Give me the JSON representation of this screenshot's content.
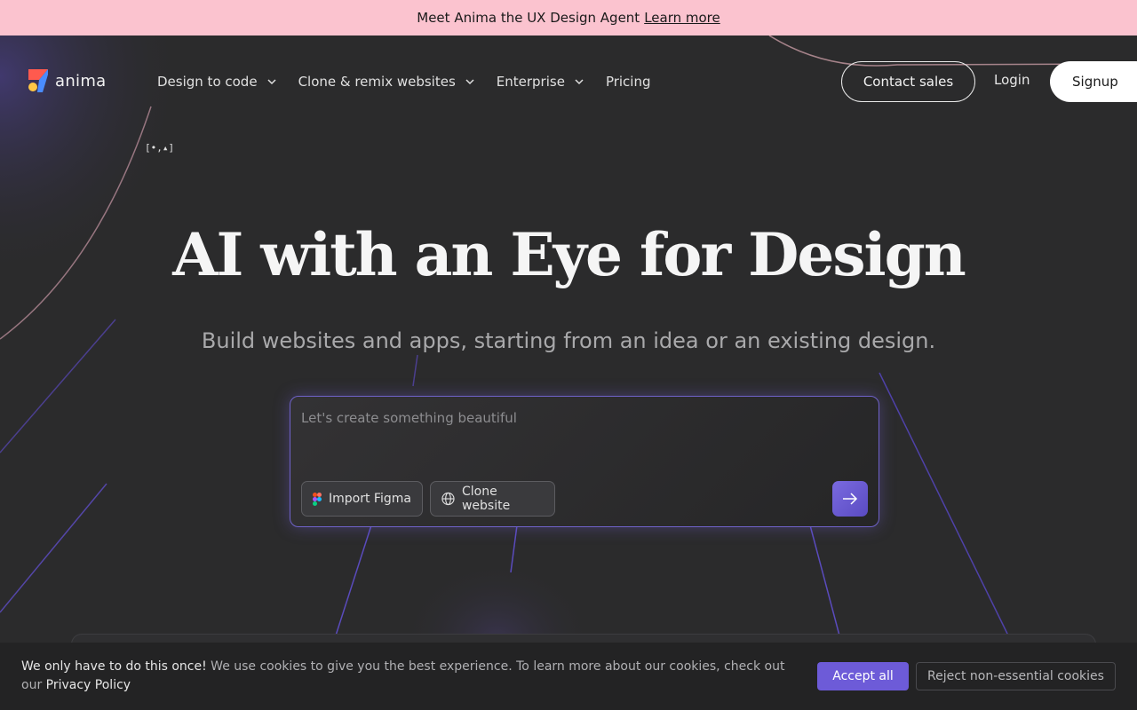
{
  "banner": {
    "text": "Meet Anima the UX Design Agent",
    "link": "Learn more"
  },
  "logo": {
    "wordmark": "anima"
  },
  "nav": {
    "items": [
      {
        "label": "Design to code",
        "dropdown": true
      },
      {
        "label": "Clone & remix websites",
        "dropdown": true
      },
      {
        "label": "Enterprise",
        "dropdown": true
      },
      {
        "label": "Pricing",
        "dropdown": false
      }
    ],
    "contact": "Contact sales",
    "login": "Login",
    "signup": "Signup"
  },
  "mascot": "[•‚▴]",
  "hero": {
    "title": "AI with an Eye for Design",
    "subtitle": "Build websites and apps, starting from an idea or an existing design."
  },
  "prompt": {
    "placeholder": "Let's create something beautiful",
    "import_figma": "Import Figma",
    "clone_website": "Clone website"
  },
  "cookie": {
    "lead": "We only have to do this once!",
    "body": "We use cookies to give you the best experience. To learn more about our cookies, check out our",
    "link": "Privacy Policy",
    "accept": "Accept all",
    "reject": "Reject non-essential cookies"
  },
  "colors": {
    "banner_bg": "#fbc3cf",
    "page_bg": "#2b2b2c",
    "accent": "#6d5bd8"
  }
}
